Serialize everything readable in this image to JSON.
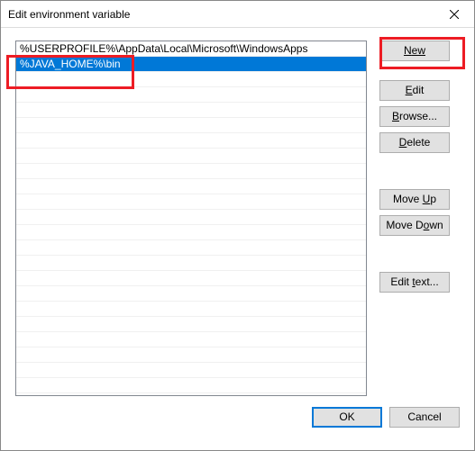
{
  "window": {
    "title": "Edit environment variable"
  },
  "list": {
    "items": [
      {
        "text": "%USERPROFILE%\\AppData\\Local\\Microsoft\\WindowsApps",
        "selected": false
      },
      {
        "text": "%JAVA_HOME%\\bin",
        "selected": true
      }
    ]
  },
  "buttons": {
    "new": "New",
    "edit": "Edit",
    "browse": "Browse...",
    "delete": "Delete",
    "moveup": "Move Up",
    "movedown": "Move Down",
    "edittext": "Edit text...",
    "ok": "OK",
    "cancel": "Cancel"
  }
}
